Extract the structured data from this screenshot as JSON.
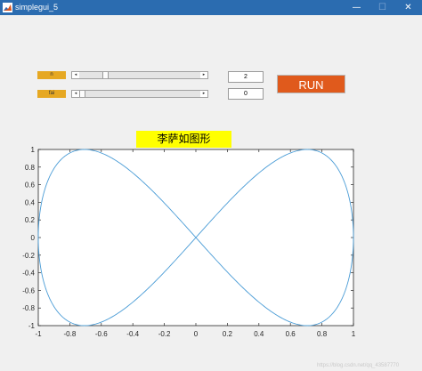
{
  "window": {
    "title": "simplegui_5",
    "minimize_glyph": "—",
    "maximize_glyph": "☐",
    "close_glyph": "✕",
    "app_icon": "matlab-icon"
  },
  "controls": {
    "n": {
      "label": "n",
      "value": "2",
      "slider_fraction": 0.2
    },
    "fai": {
      "label": "fai",
      "value": "0",
      "slider_fraction": 0.0
    },
    "run_label": "RUN",
    "arrow_left": "◂",
    "arrow_right": "▸"
  },
  "colors": {
    "titlebar": "#2b6cb0",
    "label_bg": "#e6a822",
    "run_bg": "#e05a1c",
    "title_bg": "#ffff00",
    "curve": "#4a9cd6"
  },
  "chart_data": {
    "type": "line",
    "title": "李萨如图形",
    "xlabel": "",
    "ylabel": "",
    "xlim": [
      -1,
      1
    ],
    "ylim": [
      -1,
      1
    ],
    "grid": false,
    "x_ticks": [
      "-1",
      "-0.8",
      "-0.6",
      "-0.4",
      "-0.2",
      "0",
      "0.2",
      "0.4",
      "0.6",
      "0.8",
      "1"
    ],
    "y_ticks": [
      "1",
      "0.8",
      "0.6",
      "0.4",
      "0.2",
      "0",
      "-0.2",
      "-0.4",
      "-0.6",
      "-0.8",
      "-1"
    ],
    "series": [
      {
        "equation_x": "sin(t)",
        "equation_y": "sin(2t + 0)",
        "n": 2,
        "fai": 0
      }
    ]
  },
  "watermark": "https://blog.csdn.net/qq_43587770"
}
